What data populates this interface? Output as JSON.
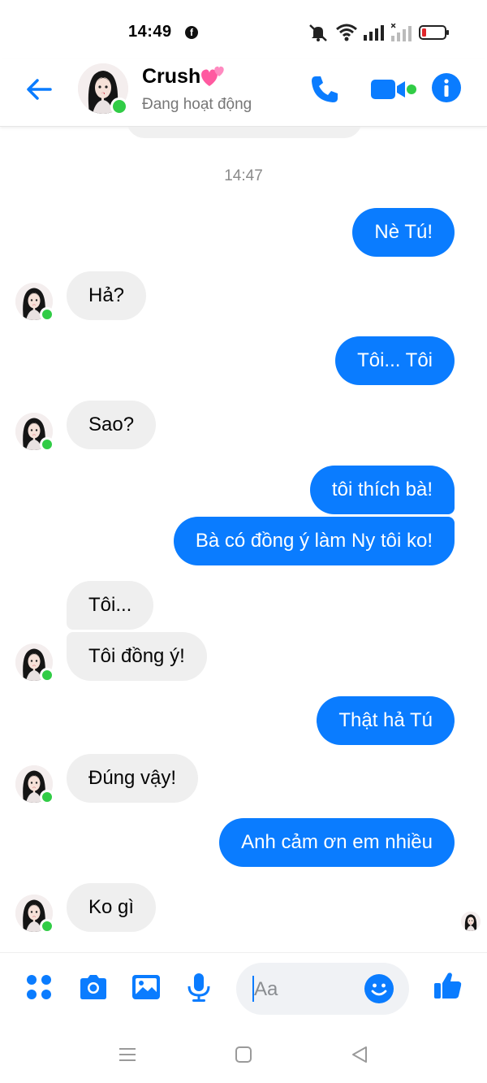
{
  "status_bar": {
    "time": "14:49",
    "fb_glyph": "f",
    "icons": [
      "facebook-icon",
      "mute-icon",
      "wifi-icon",
      "signal-icon",
      "signal-no-sim-icon",
      "battery-low-icon"
    ]
  },
  "header": {
    "contact_name": "Crush",
    "name_emoji": "pink-hearts-icon",
    "status": "Đang hoạt động",
    "icons": [
      "back-arrow-icon",
      "phone-icon",
      "video-camera-icon",
      "info-icon"
    ]
  },
  "thread": {
    "timestamp": "14:47",
    "messages": [
      {
        "from": "me",
        "text": "Nè Tú!"
      },
      {
        "from": "them",
        "text": "Hả?"
      },
      {
        "from": "me",
        "text": "Tôi... Tôi"
      },
      {
        "from": "them",
        "text": "Sao?"
      },
      {
        "from": "me",
        "text": "tôi thích bà!"
      },
      {
        "from": "me",
        "text": "Bà có đồng ý làm Ny tôi ko!"
      },
      {
        "from": "them",
        "text": "Tôi..."
      },
      {
        "from": "them",
        "text": "Tôi đồng ý!"
      },
      {
        "from": "me",
        "text": "Thật hả Tú"
      },
      {
        "from": "them",
        "text": "Đúng vậy!"
      },
      {
        "from": "me",
        "text": "Anh cảm ơn em nhiều"
      },
      {
        "from": "them",
        "text": "Ko gì"
      }
    ]
  },
  "composer": {
    "placeholder": "Aa",
    "icons": [
      "apps-icon",
      "camera-icon",
      "gallery-icon",
      "microphone-icon",
      "emoji-icon",
      "thumbs-up-icon"
    ]
  },
  "navbar": {
    "icons": [
      "menu-icon",
      "home-icon",
      "back-icon"
    ]
  },
  "colors": {
    "accent": "#0a7cff",
    "incoming_bubble": "#efefef",
    "online": "#31cc46"
  }
}
